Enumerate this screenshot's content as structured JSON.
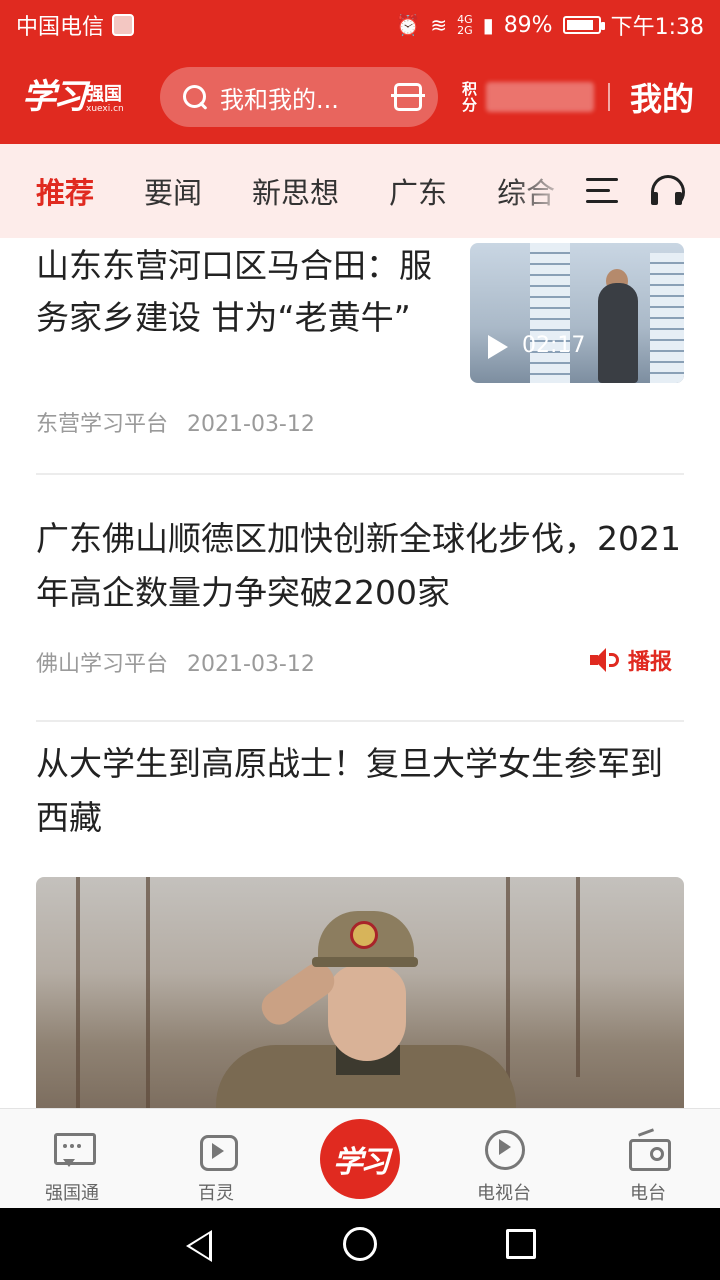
{
  "status_bar": {
    "carrier": "中国电信",
    "network": "4G\n2G",
    "battery": "89%",
    "time": "下午1:38",
    "battery_level": 0.89,
    "icons": [
      "alarm-icon",
      "wifi-icon",
      "signal-icon",
      "battery-icon"
    ]
  },
  "header": {
    "logo_script": "学习",
    "logo_main": "强国",
    "logo_sub": "xuexi.cn",
    "search_placeholder": "我和我的...",
    "points_label": "积分",
    "mine_label": "我的",
    "accent_color": "#e02a20"
  },
  "tabs": [
    {
      "label": "推荐",
      "active": true
    },
    {
      "label": "要闻",
      "active": false
    },
    {
      "label": "新思想",
      "active": false
    },
    {
      "label": "广东",
      "active": false
    },
    {
      "label": "综合",
      "active": false
    }
  ],
  "feed": {
    "articles": [
      {
        "title": "山东东营河口区马合田：服务家乡建设 甘为“老黄牛”",
        "source": "东营学习平台",
        "date": "2021-03-12",
        "video_duration": "02:17"
      },
      {
        "title": "广东佛山顺德区加快创新全球化步伐，2021年高企数量力争突破2200家",
        "source": "佛山学习平台",
        "date": "2021-03-12",
        "action_label": "播报"
      },
      {
        "title": "从大学生到高原战士！复旦大学女生参军到西藏"
      }
    ]
  },
  "bottom_nav": {
    "items": [
      {
        "label": "强国通",
        "icon": "chat-icon"
      },
      {
        "label": "百灵",
        "icon": "baling-icon"
      },
      {
        "label": "",
        "icon": "xuexi-center-icon"
      },
      {
        "label": "电视台",
        "icon": "tv-icon"
      },
      {
        "label": "电台",
        "icon": "radio-icon"
      }
    ],
    "center_label": "学习"
  }
}
